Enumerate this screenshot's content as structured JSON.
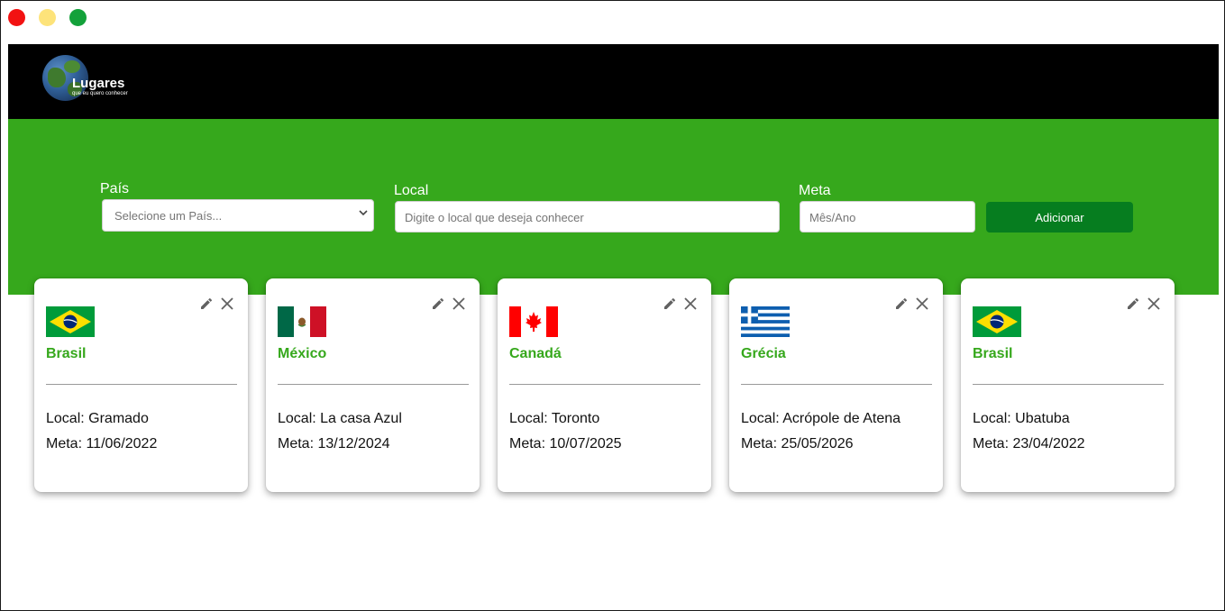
{
  "brand": {
    "title": "Lugares",
    "subtitle": "que eu quero conhecer"
  },
  "form": {
    "country_label": "País",
    "country_placeholder": "Selecione um País...",
    "local_label": "Local",
    "local_placeholder": "Digite o local que deseja conhecer",
    "meta_label": "Meta",
    "meta_placeholder": "Mês/Ano",
    "add_label": "Adicionar"
  },
  "colors": {
    "accent_green": "#36a81c",
    "button_green": "#067d1f"
  },
  "cards": [
    {
      "flag": "brazil-flag",
      "country": "Brasil",
      "local": "Local: Gramado",
      "meta": "Meta: 11/06/2022"
    },
    {
      "flag": "mexico-flag",
      "country": "México",
      "local": "Local: La casa Azul",
      "meta": "Meta: 13/12/2024"
    },
    {
      "flag": "canada-flag",
      "country": "Canadá",
      "local": "Local: Toronto",
      "meta": "Meta: 10/07/2025"
    },
    {
      "flag": "greece-flag",
      "country": "Grécia",
      "local": "Local: Acrópole de Atena",
      "meta": "Meta: 25/05/2026"
    },
    {
      "flag": "brazil-flag",
      "country": "Brasil",
      "local": "Local: Ubatuba",
      "meta": "Meta: 23/04/2022"
    }
  ]
}
